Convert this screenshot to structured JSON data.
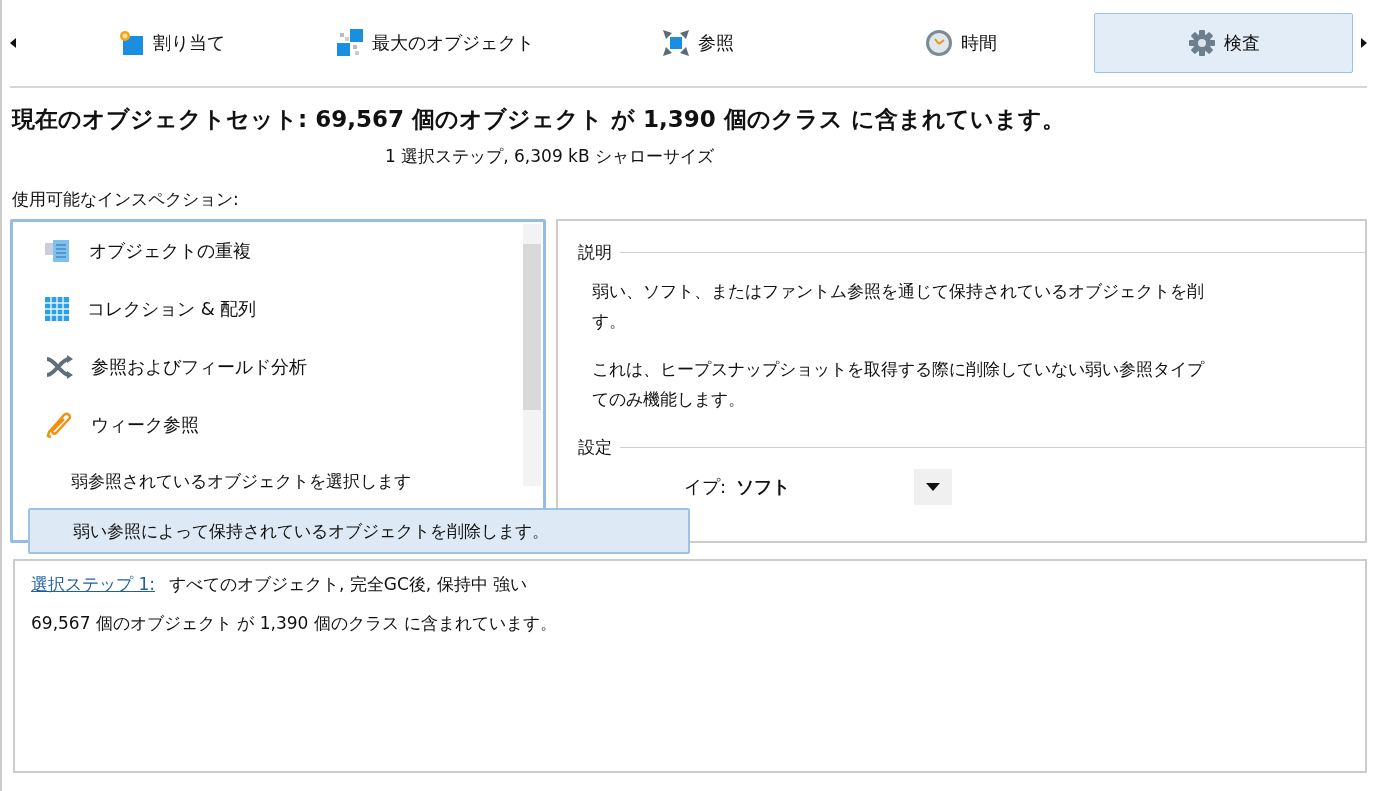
{
  "tabs": [
    {
      "label": "割り当て",
      "selected": false
    },
    {
      "label": "最大のオブジェクト",
      "selected": false
    },
    {
      "label": "参照",
      "selected": false
    },
    {
      "label": "時間",
      "selected": false
    },
    {
      "label": "検査",
      "selected": true
    }
  ],
  "heading": "現在のオブジェクトセット:  69,567 個のオブジェクト が 1,390 個のクラス に含まれています。",
  "subheading": "1 選択ステップ, 6,309 kB シャローサイズ",
  "inspections_label": "使用可能なインスペクション:",
  "inspections": [
    {
      "label": "オブジェクトの重複",
      "selected": false
    },
    {
      "label": "コレクション & 配列",
      "selected": false
    },
    {
      "label": "参照およびフィールド分析",
      "selected": false
    },
    {
      "label": "ウィーク参照",
      "selected": false,
      "children": [
        {
          "label": "弱参照されているオブジェクトを選択します",
          "selected": false
        },
        {
          "label": "弱い参照によって保持されているオブジェクトを削除します。",
          "selected": true
        }
      ]
    }
  ],
  "description": {
    "title": "説明",
    "paragraphs": [
      [
        "弱い、ソフト、またはファントム参照を通じて保持されているオブジェクトを削",
        "す。"
      ],
      [
        "これは、ヒープスナップショットを取得する際に削除していない弱い参照タイプ",
        "てのみ機能します。"
      ]
    ]
  },
  "settings": {
    "title": "設定",
    "label": "イプ:",
    "value": "ソフト"
  },
  "selection": {
    "link": "選択ステップ 1:",
    "description": "すべてのオブジェクト, 完全GC後, 保持中 強い",
    "summary": "69,567 個のオブジェクト が 1,390 個のクラス に含まれています。"
  }
}
